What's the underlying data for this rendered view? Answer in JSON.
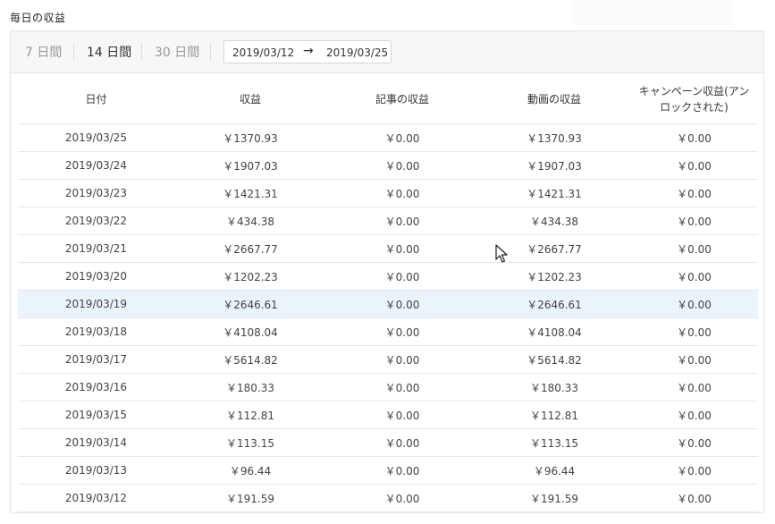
{
  "section_title": "毎日の収益",
  "range_tabs": [
    {
      "label": "7 日間",
      "active": false
    },
    {
      "label": "14 日間",
      "active": true
    },
    {
      "label": "30 日間",
      "active": false
    }
  ],
  "date_range": {
    "start": "2019/03/12",
    "arrow": "→",
    "end": "2019/03/25"
  },
  "table": {
    "headers": [
      "日付",
      "収益",
      "記事の収益",
      "動画の収益",
      "キャンペーン収益(アンロックされた)"
    ],
    "highlighted_row": "2019/03/19",
    "rows": [
      [
        "2019/03/25",
        "￥1370.93",
        "￥0.00",
        "￥1370.93",
        "￥0.00"
      ],
      [
        "2019/03/24",
        "￥1907.03",
        "￥0.00",
        "￥1907.03",
        "￥0.00"
      ],
      [
        "2019/03/23",
        "￥1421.31",
        "￥0.00",
        "￥1421.31",
        "￥0.00"
      ],
      [
        "2019/03/22",
        "￥434.38",
        "￥0.00",
        "￥434.38",
        "￥0.00"
      ],
      [
        "2019/03/21",
        "￥2667.77",
        "￥0.00",
        "￥2667.77",
        "￥0.00"
      ],
      [
        "2019/03/20",
        "￥1202.23",
        "￥0.00",
        "￥1202.23",
        "￥0.00"
      ],
      [
        "2019/03/19",
        "￥2646.61",
        "￥0.00",
        "￥2646.61",
        "￥0.00"
      ],
      [
        "2019/03/18",
        "￥4108.04",
        "￥0.00",
        "￥4108.04",
        "￥0.00"
      ],
      [
        "2019/03/17",
        "￥5614.82",
        "￥0.00",
        "￥5614.82",
        "￥0.00"
      ],
      [
        "2019/03/16",
        "￥180.33",
        "￥0.00",
        "￥180.33",
        "￥0.00"
      ],
      [
        "2019/03/15",
        "￥112.81",
        "￥0.00",
        "￥112.81",
        "￥0.00"
      ],
      [
        "2019/03/14",
        "￥113.15",
        "￥0.00",
        "￥113.15",
        "￥0.00"
      ],
      [
        "2019/03/13",
        "￥96.44",
        "￥0.00",
        "￥96.44",
        "￥0.00"
      ],
      [
        "2019/03/12",
        "￥191.59",
        "￥0.00",
        "￥191.59",
        "￥0.00"
      ]
    ]
  },
  "colors": {
    "toolbar_bg": "#f7f7f7",
    "border": "#e6e6e6",
    "highlight_row": "#eaf4fb",
    "inactive_tab": "#999999",
    "active_tab": "#333333"
  }
}
